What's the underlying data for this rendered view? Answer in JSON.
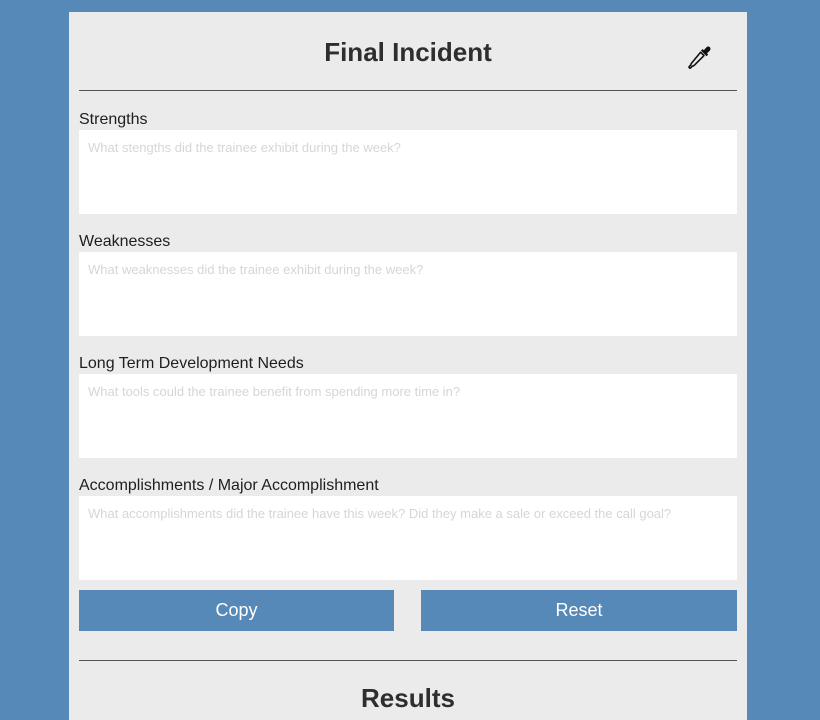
{
  "header": {
    "title": "Final Incident",
    "color_picker_icon": "eyedropper-icon"
  },
  "fields": [
    {
      "label": "Strengths",
      "placeholder": "What stengths did the trainee exhibit during the week?",
      "value": ""
    },
    {
      "label": "Weaknesses",
      "placeholder": "What weaknesses did the trainee exhibit during the week?",
      "value": ""
    },
    {
      "label": "Long Term Development Needs",
      "placeholder": "What tools could the trainee benefit from spending more time in?",
      "value": ""
    },
    {
      "label": "Accomplishments / Major Accomplishment",
      "placeholder": "What accomplishments did the trainee have this week? Did they make a sale or exceed the call goal?",
      "value": ""
    }
  ],
  "actions": {
    "copy_label": "Copy",
    "reset_label": "Reset"
  },
  "results": {
    "title": "Results"
  },
  "colors": {
    "background": "#5688b8",
    "card": "#ebebeb",
    "button": "#5688b8",
    "button_text": "#ffffff",
    "placeholder": "#d6d6d6"
  }
}
